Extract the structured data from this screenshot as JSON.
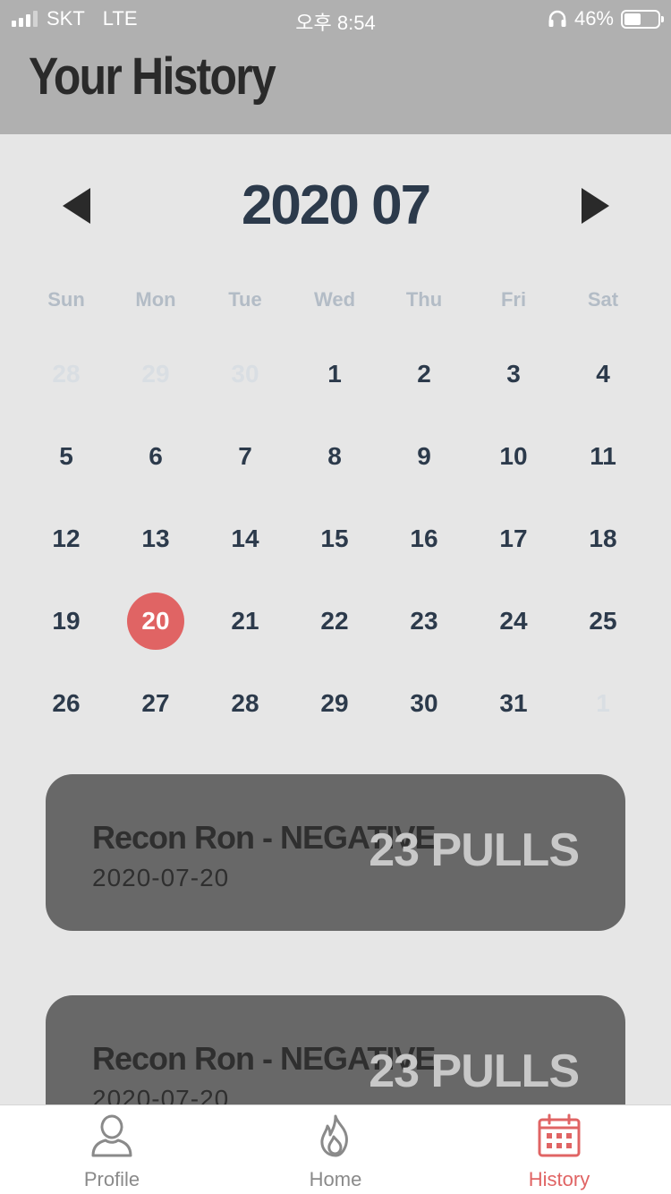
{
  "status_bar": {
    "carrier": "SKT",
    "network": "LTE",
    "time": "오후 8:54",
    "battery": "46%",
    "battery_level": 0.46
  },
  "header": {
    "title": "Your History"
  },
  "calendar": {
    "month_label": "2020 07",
    "weekdays": [
      "Sun",
      "Mon",
      "Tue",
      "Wed",
      "Thu",
      "Fri",
      "Sat"
    ],
    "days": [
      {
        "label": "28",
        "muted": true
      },
      {
        "label": "29",
        "muted": true
      },
      {
        "label": "30",
        "muted": true
      },
      {
        "label": "1"
      },
      {
        "label": "2"
      },
      {
        "label": "3"
      },
      {
        "label": "4"
      },
      {
        "label": "5"
      },
      {
        "label": "6"
      },
      {
        "label": "7"
      },
      {
        "label": "8"
      },
      {
        "label": "9"
      },
      {
        "label": "10"
      },
      {
        "label": "11"
      },
      {
        "label": "12"
      },
      {
        "label": "13"
      },
      {
        "label": "14"
      },
      {
        "label": "15"
      },
      {
        "label": "16"
      },
      {
        "label": "17"
      },
      {
        "label": "18"
      },
      {
        "label": "19"
      },
      {
        "label": "20",
        "selected": true
      },
      {
        "label": "21"
      },
      {
        "label": "22"
      },
      {
        "label": "23"
      },
      {
        "label": "24"
      },
      {
        "label": "25"
      },
      {
        "label": "26"
      },
      {
        "label": "27"
      },
      {
        "label": "28"
      },
      {
        "label": "29"
      },
      {
        "label": "30"
      },
      {
        "label": "31"
      },
      {
        "label": "1",
        "muted": true
      }
    ]
  },
  "history_items": [
    {
      "title": "Recon Ron - NEGATIVE",
      "date": "2020-07-20",
      "pulls": "23 PULLS"
    },
    {
      "title": "Recon Ron - NEGATIVE",
      "date": "2020-07-20",
      "pulls": "23 PULLS"
    }
  ],
  "tabbar": {
    "tabs": [
      {
        "label": "Profile",
        "icon": "profile-icon",
        "active": false
      },
      {
        "label": "Home",
        "icon": "flame-icon",
        "active": false
      },
      {
        "label": "History",
        "icon": "calendar-icon",
        "active": true
      }
    ]
  },
  "colors": {
    "header_bg": "#b0b0b0",
    "page_bg": "#e6e6e6",
    "accent": "#e06464",
    "card_bg": "#686868",
    "day_text": "#2c3a4b"
  }
}
